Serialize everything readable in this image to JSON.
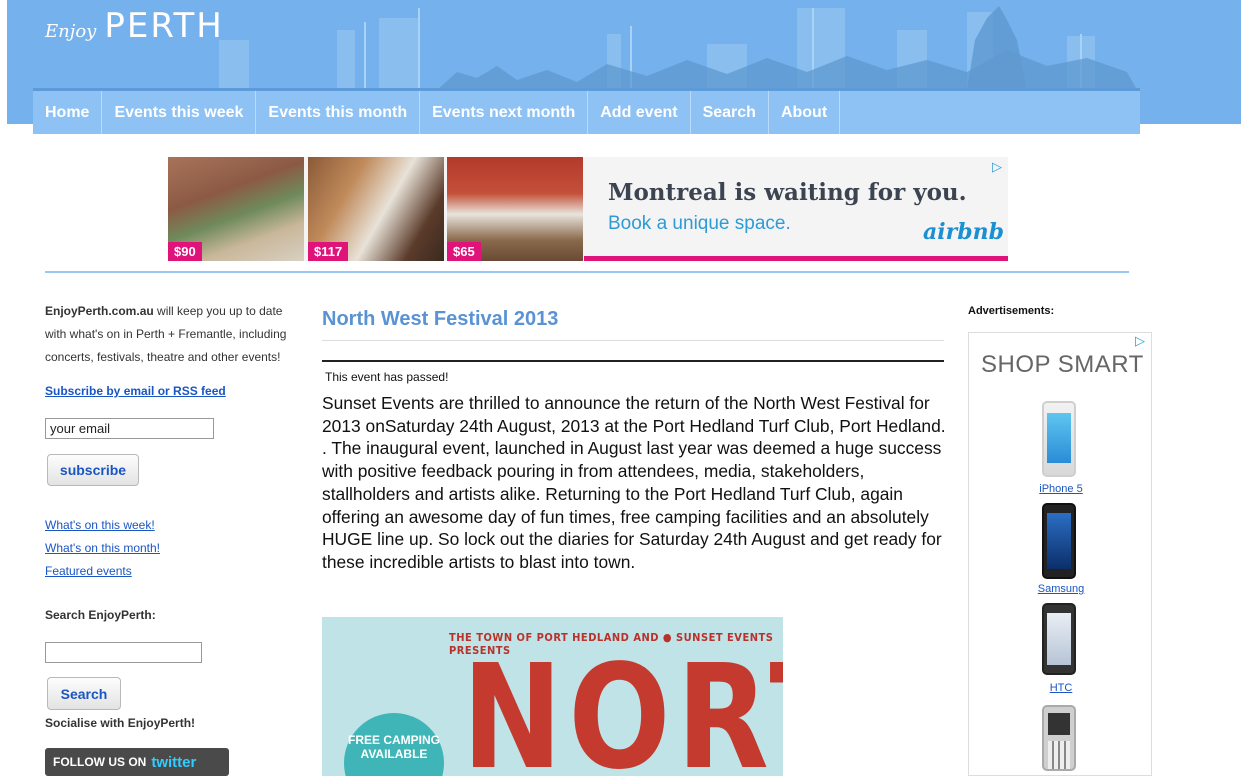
{
  "header": {
    "logo_enjoy": "Enjoy",
    "logo_perth": "PERTH",
    "nav": [
      "Home",
      "Events this week",
      "Events this month",
      "Events next month",
      "Add event",
      "Search",
      "About"
    ]
  },
  "top_ad": {
    "prices": [
      "$90",
      "$117",
      "$65"
    ],
    "headline": "Montreal is waiting for you.",
    "subline": "Book a unique space.",
    "brand": "airbnb",
    "adchoices": "▷"
  },
  "sidebar": {
    "intro_bold": "EnjoyPerth.com.au",
    "intro_rest": " will keep you up to date with what's on in Perth + Fremantle, including concerts, festivals, theatre and other events!",
    "subscribe_link": "Subscribe by email or RSS feed",
    "email_value": "your email",
    "subscribe_button": "subscribe",
    "links": [
      "What's on this week!",
      "What's on this month!",
      "Featured events"
    ],
    "search_label": "Search EnjoyPerth:",
    "search_button": "Search",
    "social_label": "Socialise with EnjoyPerth!",
    "twitter_prefix": "FOLLOW US ON",
    "twitter_brand": "twitter"
  },
  "event": {
    "title": "North West Festival 2013",
    "status": "This event has passed!",
    "description": "Sunset Events are thrilled to announce the return of the North West Festival for 2013 onSaturday 24th August, 2013 at the Port Hedland Turf Club, Port Hedland. . The inaugural event, launched in August last year was deemed a huge success with positive feedback pouring in from attendees, media, stakeholders, stallholders and artists alike. Returning to the Port Hedland Turf Club, again offering an awesome day of fun times, free camping facilities and an absolutely HUGE line up. So lock out the diaries for Saturday 24th August and get ready for these incredible artists to blast into town.",
    "poster_top": "THE TOWN OF PORT HEDLAND AND ● SUNSET EVENTS PRESENTS",
    "poster_title": "NORTH",
    "poster_badge": "FREE CAMPING AVAILABLE"
  },
  "right_ad": {
    "label": "Advertisements:",
    "adchoices": "▷",
    "heading": "SHOP SMART",
    "products": [
      "iPhone 5",
      "Samsung",
      "HTC"
    ]
  }
}
